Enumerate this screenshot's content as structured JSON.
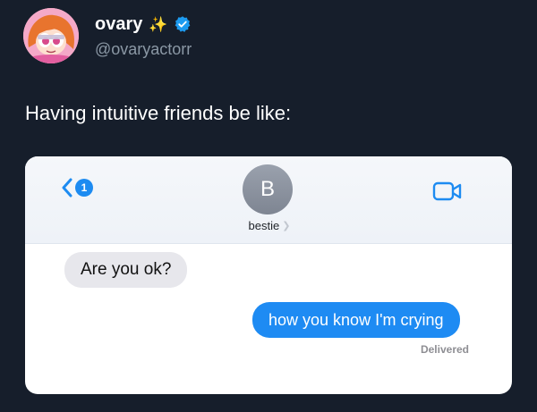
{
  "tweet": {
    "display_name": "ovary",
    "name_emoji": "✨",
    "handle": "@ovaryactorr",
    "verified": true,
    "text": "Having intuitive friends be like:"
  },
  "screenshot": {
    "unread_count": "1",
    "contact_initial": "B",
    "contact_name": "bestie",
    "messages": [
      {
        "direction": "incoming",
        "text": "Are you ok?"
      },
      {
        "direction": "outgoing",
        "text": "how you know I'm crying"
      }
    ],
    "delivery_status": "Delivered"
  },
  "colors": {
    "page_background": "#161e2b",
    "outgoing_bubble": "#1e8bf3",
    "incoming_bubble": "#e7e7ec",
    "verified_badge": "#1d9bf0",
    "ios_blue": "#1d8bf1"
  }
}
